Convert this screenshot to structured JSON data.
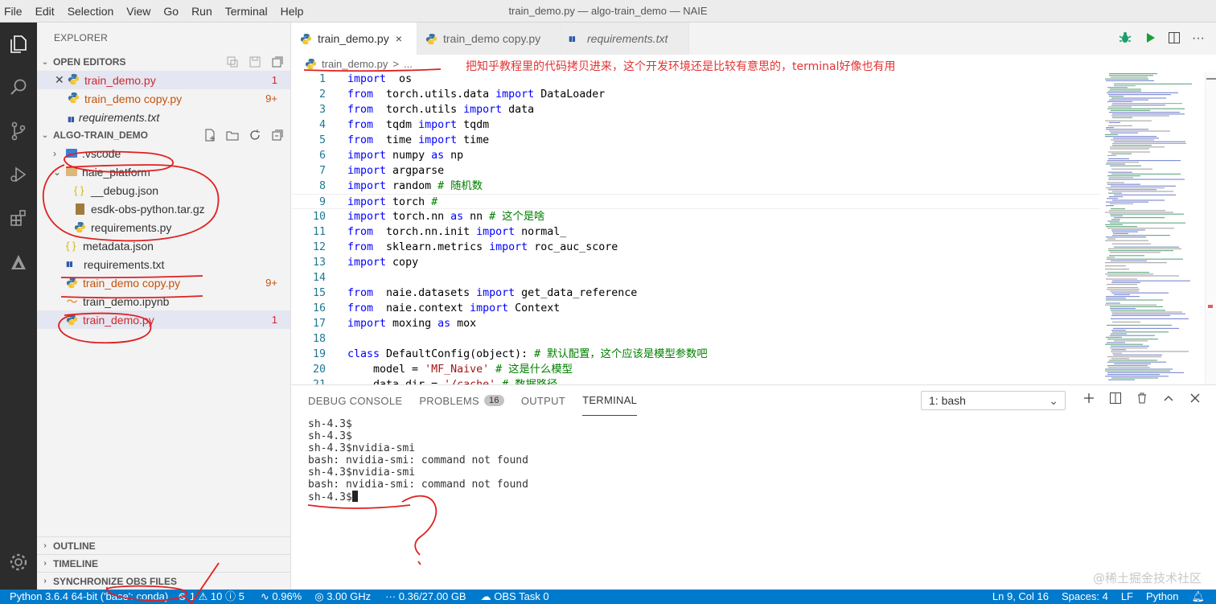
{
  "window_title": "train_demo.py — algo-train_demo — NAIE",
  "menu": [
    "File",
    "Edit",
    "Selection",
    "View",
    "Go",
    "Run",
    "Terminal",
    "Help"
  ],
  "activity_icons": [
    "files-icon",
    "search-icon",
    "source-control-icon",
    "run-debug-icon",
    "extensions-icon",
    "naie-icon",
    "settings-gear-icon"
  ],
  "sidebar": {
    "title": "EXPLORER",
    "open_editors_label": "OPEN EDITORS",
    "open_editors": [
      {
        "name": "train_demo.py",
        "badge": "1",
        "status": "error",
        "closable": true
      },
      {
        "name": "train_demo copy.py",
        "badge": "9+",
        "status": "modified"
      },
      {
        "name": "requirements.txt",
        "badge": "",
        "status": "italic"
      }
    ],
    "workspace_label": "ALGO-TRAIN_DEMO",
    "tree": [
      {
        "name": ".vscode",
        "kind": "folder",
        "indent": 1
      },
      {
        "name": "naie_platform",
        "kind": "folder",
        "indent": 1,
        "open": true
      },
      {
        "name": "__debug.json",
        "kind": "json",
        "indent": 2
      },
      {
        "name": "esdk-obs-python.tar.gz",
        "kind": "archive",
        "indent": 2
      },
      {
        "name": "requirements.py",
        "kind": "python",
        "indent": 2
      },
      {
        "name": "metadata.json",
        "kind": "json",
        "indent": 1
      },
      {
        "name": "requirements.txt",
        "kind": "req",
        "indent": 1
      },
      {
        "name": "train_demo copy.py",
        "kind": "python",
        "indent": 1,
        "badge": "9+",
        "status": "modified"
      },
      {
        "name": "train_demo.ipynb",
        "kind": "notebook",
        "indent": 1
      },
      {
        "name": "train_demo.py",
        "kind": "python",
        "indent": 1,
        "badge": "1",
        "status": "error",
        "selected": true
      }
    ],
    "bottom_sections": [
      "OUTLINE",
      "TIMELINE",
      "SYNCHRONIZE OBS FILES"
    ]
  },
  "tabs": [
    {
      "label": "train_demo.py",
      "active": true,
      "close": "×"
    },
    {
      "label": "train_demo copy.py",
      "active": false
    },
    {
      "label": "requirements.txt",
      "active": false,
      "italic": true
    }
  ],
  "breadcrumb": {
    "file": "train_demo.py",
    "sep": ">",
    "more": "..."
  },
  "annotation_text": "把知乎教程里的代码拷贝进来，这个开发环境还是比较有意思的，terminal好像也有用",
  "code_lines": [
    {
      "n": "1",
      "t": [
        [
          "kw",
          "import"
        ],
        [
          "",
          "  os"
        ]
      ]
    },
    {
      "n": "2",
      "t": [
        [
          "kw",
          "from"
        ],
        [
          "",
          "  torch.utils.data "
        ],
        [
          "kw",
          "import"
        ],
        [
          "",
          " DataLoader"
        ]
      ]
    },
    {
      "n": "3",
      "t": [
        [
          "kw",
          "from"
        ],
        [
          "",
          "  torch.utils "
        ],
        [
          "kw",
          "import"
        ],
        [
          "",
          " data"
        ]
      ]
    },
    {
      "n": "4",
      "t": [
        [
          "kw",
          "from"
        ],
        [
          "",
          "  tqdm "
        ],
        [
          "kw",
          "import"
        ],
        [
          "",
          " tqdm"
        ]
      ]
    },
    {
      "n": "5",
      "t": [
        [
          "kw",
          "from"
        ],
        [
          "",
          "  time "
        ],
        [
          "kw",
          "import"
        ],
        [
          "",
          " time"
        ]
      ]
    },
    {
      "n": "6",
      "t": [
        [
          "kw",
          "import"
        ],
        [
          "",
          " numpy "
        ],
        [
          "kw",
          "as"
        ],
        [
          "",
          " np"
        ]
      ]
    },
    {
      "n": "7",
      "t": [
        [
          "kw",
          "import"
        ],
        [
          "",
          " argparse"
        ]
      ]
    },
    {
      "n": "8",
      "t": [
        [
          "kw",
          "import"
        ],
        [
          "",
          " random "
        ],
        [
          "cm",
          "# 随机数"
        ]
      ]
    },
    {
      "n": "9",
      "t": [
        [
          "kw",
          "import"
        ],
        [
          "",
          " torch "
        ],
        [
          "cm",
          "#"
        ]
      ]
    },
    {
      "n": "10",
      "t": [
        [
          "kw",
          "import"
        ],
        [
          "",
          " torch.nn "
        ],
        [
          "kw",
          "as"
        ],
        [
          "",
          " nn "
        ],
        [
          "cm",
          "# 这个是啥"
        ]
      ]
    },
    {
      "n": "11",
      "t": [
        [
          "kw",
          "from"
        ],
        [
          "",
          "  torch.nn.init "
        ],
        [
          "kw",
          "import"
        ],
        [
          "",
          " normal_"
        ]
      ]
    },
    {
      "n": "12",
      "t": [
        [
          "kw",
          "from"
        ],
        [
          "",
          "  sklearn.metrics "
        ],
        [
          "kw",
          "import"
        ],
        [
          "",
          " roc_auc_score"
        ]
      ]
    },
    {
      "n": "13",
      "t": [
        [
          "kw",
          "import"
        ],
        [
          "",
          " copy"
        ]
      ]
    },
    {
      "n": "14",
      "t": []
    },
    {
      "n": "15",
      "t": [
        [
          "kw",
          "from"
        ],
        [
          "",
          "  naie.datasets "
        ],
        [
          "kw",
          "import"
        ],
        [
          "",
          " get_data_reference"
        ]
      ]
    },
    {
      "n": "16",
      "t": [
        [
          "kw",
          "from"
        ],
        [
          "",
          "  naie.context "
        ],
        [
          "kw",
          "import"
        ],
        [
          "",
          " Context"
        ]
      ]
    },
    {
      "n": "17",
      "t": [
        [
          "kw",
          "import"
        ],
        [
          "",
          " moxing "
        ],
        [
          "kw",
          "as"
        ],
        [
          "",
          " mox"
        ]
      ]
    },
    {
      "n": "18",
      "t": []
    },
    {
      "n": "19",
      "t": [
        [
          "kw",
          "class"
        ],
        [
          "",
          " DefaultConfig(object): "
        ],
        [
          "cm",
          "# 默认配置，这个应该是模型参数吧"
        ]
      ]
    },
    {
      "n": "20",
      "t": [
        [
          "",
          "    model = "
        ],
        [
          "st",
          "'MF_Naive'"
        ],
        [
          "",
          " "
        ],
        [
          "cm",
          "# 这是什么模型"
        ]
      ]
    },
    {
      "n": "21",
      "t": [
        [
          "",
          "    data_dir = "
        ],
        [
          "st",
          "'/cache'"
        ],
        [
          "",
          " "
        ],
        [
          "cm",
          "# 数据路径"
        ]
      ]
    }
  ],
  "panel": {
    "tabs": [
      "DEBUG CONSOLE",
      "PROBLEMS",
      "OUTPUT",
      "TERMINAL"
    ],
    "problems_count": "16",
    "active": "TERMINAL",
    "terminal_select": "1: bash",
    "terminal_lines": [
      "sh-4.3$",
      "sh-4.3$",
      "sh-4.3$nvidia-smi",
      "bash: nvidia-smi: command not found",
      "sh-4.3$nvidia-smi",
      "bash: nvidia-smi: command not found",
      "sh-4.3$"
    ]
  },
  "status": {
    "interpreter": "Python 3.6.4 64-bit ('base': conda)",
    "errors": "1",
    "warnings": "10",
    "infos": "5",
    "cpu": "0.96%",
    "freq": "3.00 GHz",
    "mem": "0.36/27.00 GB",
    "obs": "OBS Task 0",
    "position": "Ln 9, Col 16",
    "spaces": "Spaces: 4",
    "eol": "LF",
    "language": "Python"
  },
  "watermark": "@稀土掘金技术社区",
  "colors": {
    "status_bar": "#007acc",
    "activity_bar": "#2c2c2c",
    "annotation": "#e23333"
  }
}
